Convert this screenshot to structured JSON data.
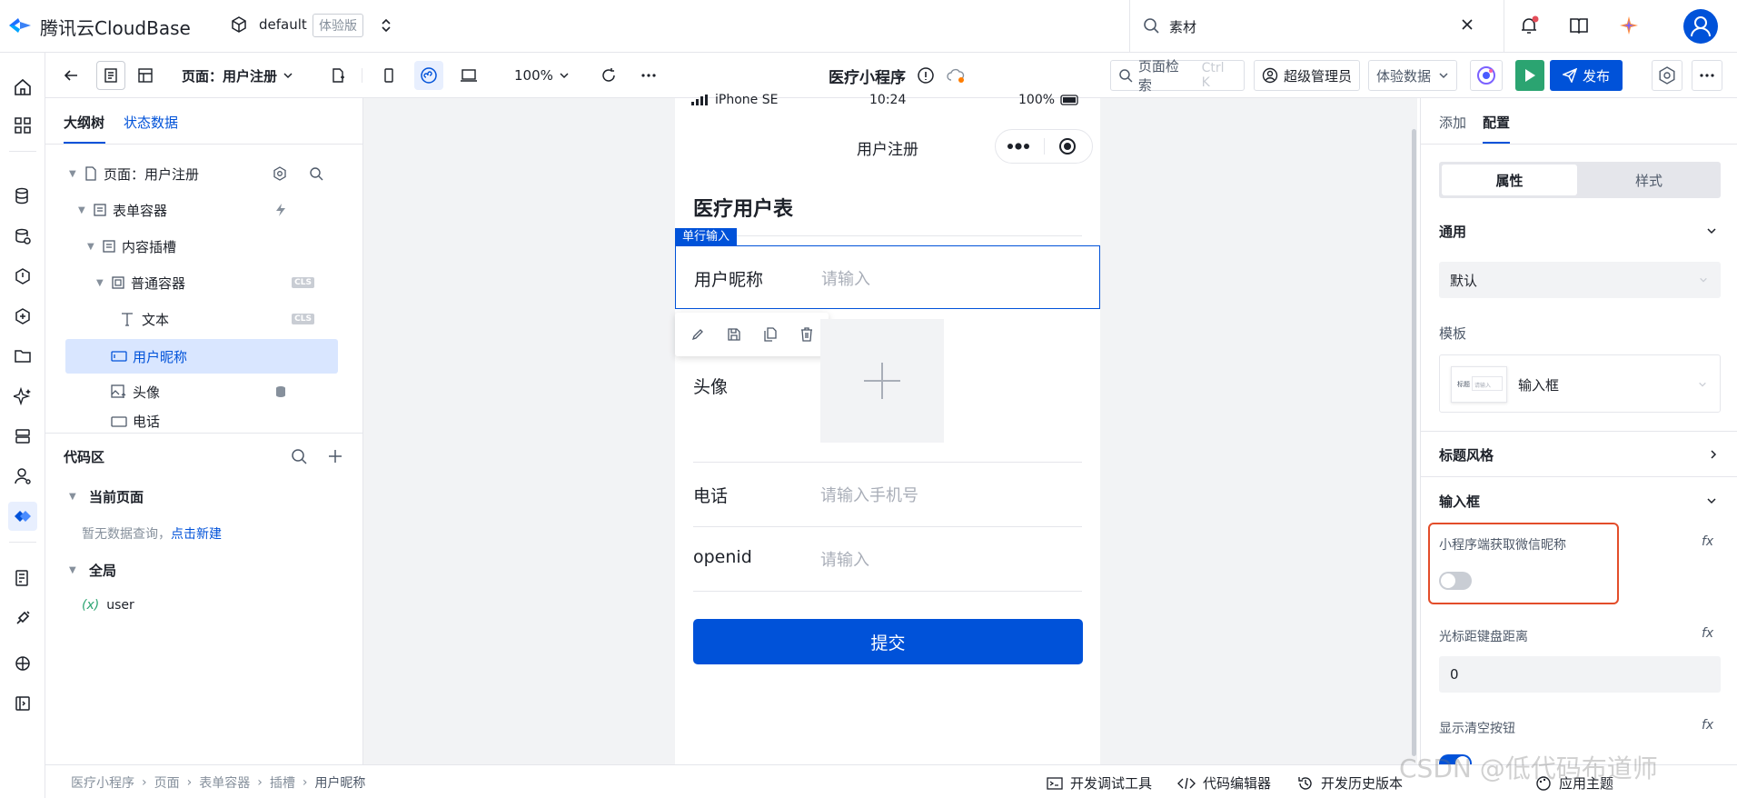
{
  "topbar": {
    "logo_text": "腾讯云CloudBase",
    "env_name": "default",
    "env_badge": "体验版",
    "search_value": "素材"
  },
  "toolbar": {
    "page_label": "页面：用户注册",
    "zoom": "100%",
    "app_title": "医疗小程序",
    "page_search": "页面检索",
    "page_search_shortcut": "Ctrl K",
    "role": "超级管理员",
    "data_mode": "体验数据",
    "publish": "发布"
  },
  "left_panel": {
    "tabs": [
      "大纲树",
      "状态数据"
    ],
    "tree": [
      {
        "label": "页面：用户注册"
      },
      {
        "label": "表单容器"
      },
      {
        "label": "内容插槽"
      },
      {
        "label": "普通容器",
        "badge": "CLS"
      },
      {
        "label": "文本",
        "badge": "CLS"
      },
      {
        "label": "用户昵称"
      },
      {
        "label": "头像"
      },
      {
        "label": "电话"
      }
    ],
    "code_area": {
      "title": "代码区",
      "current_page": "当前页面",
      "empty_hint": "暂无数据查询，",
      "create_link": "点击新建",
      "global": "全局",
      "global_var_prefix": "(x)",
      "global_var": "user"
    }
  },
  "phone": {
    "status_carrier": "iPhone SE",
    "status_time": "10:24",
    "status_battery": "100%",
    "nav_title": "用户注册",
    "form_title": "医疗用户表",
    "selected_tag": "单行输入",
    "fields": [
      {
        "label": "用户昵称",
        "placeholder": "请输入"
      },
      {
        "label": "头像",
        "placeholder": ""
      },
      {
        "label": "电话",
        "placeholder": "请输入手机号"
      },
      {
        "label": "openid",
        "placeholder": "请输入"
      }
    ],
    "submit": "提交"
  },
  "right_panel": {
    "tabs": [
      "添加",
      "配置"
    ],
    "segment": [
      "属性",
      "样式"
    ],
    "general_title": "通用",
    "general_value": "默认",
    "template_label": "模板",
    "template_value": "输入框",
    "template_thumb_label": "标题",
    "template_thumb_placeholder": "请输入",
    "title_style": "标题风格",
    "input_section": "输入框",
    "wechat_nick_label": "小程序端获取微信昵称",
    "wechat_nick_enabled": false,
    "cursor_distance_label": "光标距键盘距离",
    "cursor_distance_value": "0",
    "show_clear_label": "显示清空按钮",
    "show_clear_enabled": true,
    "fx": "fx"
  },
  "bottombar": {
    "breadcrumb": [
      "医疗小程序",
      "页面",
      "表单容器",
      "插槽",
      "用户昵称"
    ],
    "dev_tools": "开发调试工具",
    "code_editor": "代码编辑器",
    "history": "开发历史版本",
    "theme": "应用主题"
  },
  "watermark": "CSDN @低代码布道师",
  "colors": {
    "primary": "#0052d9",
    "highlight_border": "#e34d2a",
    "run_green": "#2ba471"
  }
}
